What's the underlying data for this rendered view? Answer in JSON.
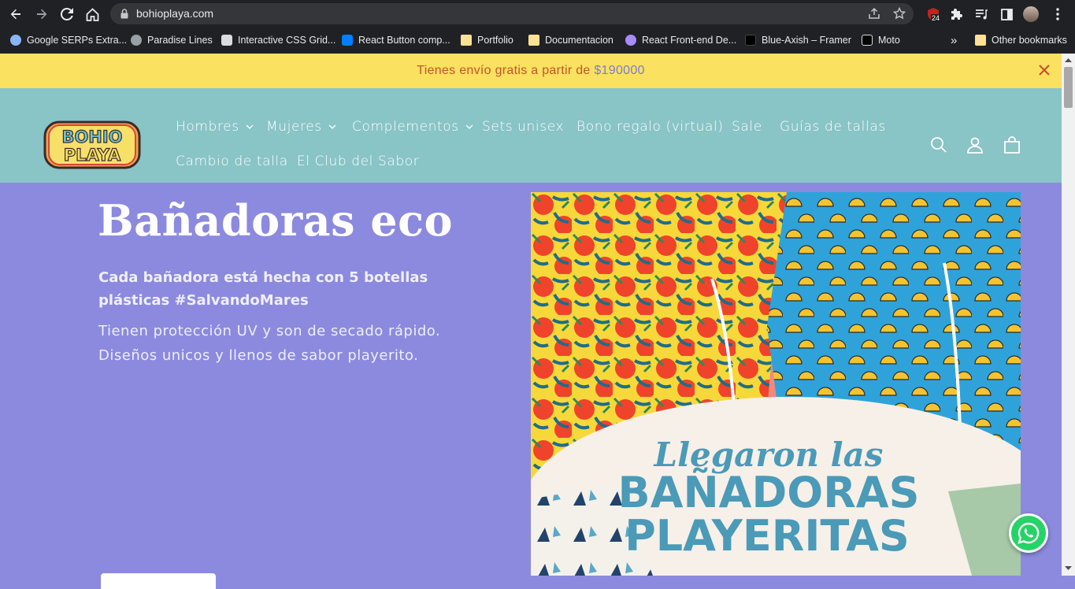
{
  "browser": {
    "url": "bohioplaya.com",
    "extension_badge": "24",
    "bookmarks": [
      {
        "label": "Google SERPs Extra...",
        "icon": "extension-icon",
        "color": "#8ab4f8"
      },
      {
        "label": "Paradise Lines",
        "icon": "globe-icon",
        "color": "#9aa0a6"
      },
      {
        "label": "Interactive CSS Grid...",
        "icon": "cube-icon",
        "color": "#dadce0"
      },
      {
        "label": "React Button comp...",
        "icon": "mui-logo-icon",
        "color": "#007fff"
      },
      {
        "label": "Portfolio",
        "icon": "folder-icon",
        "color": "#fde293"
      },
      {
        "label": "Documentacion",
        "icon": "folder-icon",
        "color": "#fde293"
      },
      {
        "label": "React Front-end De...",
        "icon": "react-icon",
        "color": "#a78bfa"
      },
      {
        "label": "Blue-Axish – Framer",
        "icon": "framer-icon",
        "color": "#000000"
      },
      {
        "label": "Moto",
        "icon": "page-icon",
        "color": "#000000"
      }
    ],
    "other_bookmarks": "Other bookmarks",
    "more_bookmarks": "»"
  },
  "announcement": {
    "text": "Tienes envío gratis a partir de",
    "price": "$190000"
  },
  "nav": {
    "items": [
      {
        "label": "Hombres",
        "dropdown": true
      },
      {
        "label": "Mujeres",
        "dropdown": true
      },
      {
        "label": "Complementos",
        "dropdown": true
      },
      {
        "label": "Sets unisex",
        "dropdown": false
      },
      {
        "label": "Bono regalo (virtual)",
        "dropdown": false
      },
      {
        "label": "Sale",
        "dropdown": false
      },
      {
        "label": "Guías de tallas",
        "dropdown": false
      },
      {
        "label": "Cambio de talla",
        "dropdown": false
      },
      {
        "label": "El Club del Sabor",
        "dropdown": false
      }
    ]
  },
  "logo": {
    "line1": "BOHIO",
    "line2": "PLAYA"
  },
  "hero": {
    "title": "Bañadoras eco",
    "subtitle": "Cada bañadora está hecha con 5 botellas plásticas #SalvandoMares",
    "description": "Tienen protección UV y son de secado rápido. Diseños unicos y llenos de sabor playerito.",
    "image_line1": "Llegaron las",
    "image_line2": "BAÑADORAS",
    "image_line3": "PLAYERITAS"
  },
  "colors": {
    "announcement_bg": "#fae15f",
    "header_bg": "#89c4c6",
    "hero_bg": "#8c8ade",
    "accent_orange": "#c2552b",
    "image_text": "#4a9ab8"
  }
}
